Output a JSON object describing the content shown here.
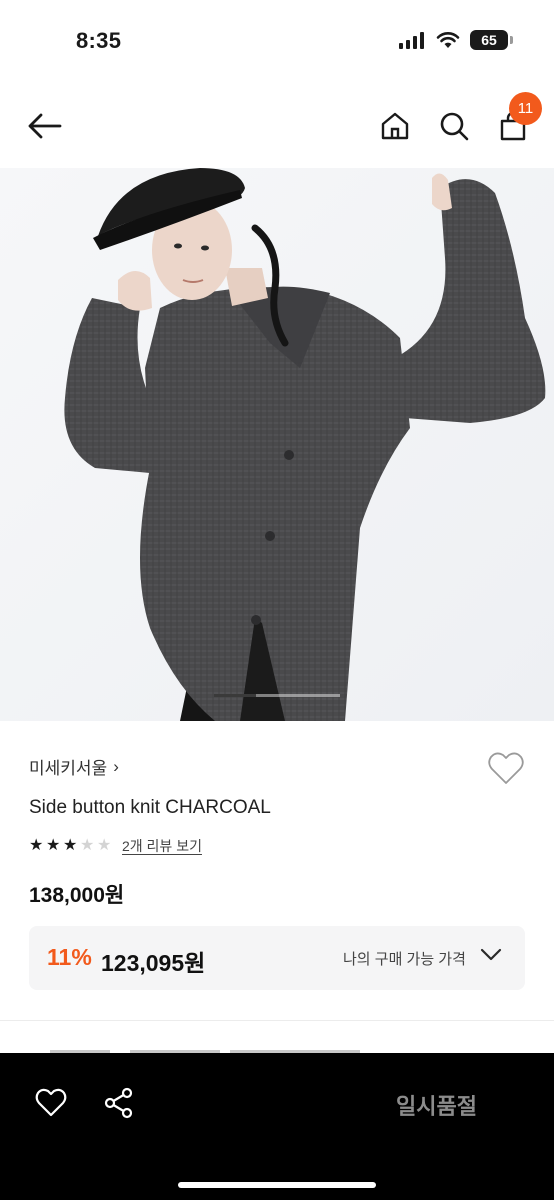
{
  "status_bar": {
    "time": "8:35",
    "battery": "65"
  },
  "nav": {
    "back_icon": "arrow-left-icon",
    "home_icon": "home-icon",
    "search_icon": "search-icon",
    "bag_icon": "shopping-bag-icon",
    "bag_badge": "11"
  },
  "carousel": {
    "current": 1,
    "total": 3
  },
  "product": {
    "brand": "미세키서울",
    "brand_chevron": "›",
    "name": "Side button knit CHARCOAL",
    "rating": 3,
    "rating_max": 5,
    "review_link": "2개 리뷰 보기",
    "price": "138,000원"
  },
  "discount": {
    "rate": "11%",
    "price": "123,095원",
    "label": "나의 구매 가능 가격"
  },
  "bottom_bar": {
    "action_label": "일시품절"
  },
  "colors": {
    "accent": "#f25a1c",
    "bottom_bar": "#000000",
    "discount_bg": "#f5f5f6"
  }
}
